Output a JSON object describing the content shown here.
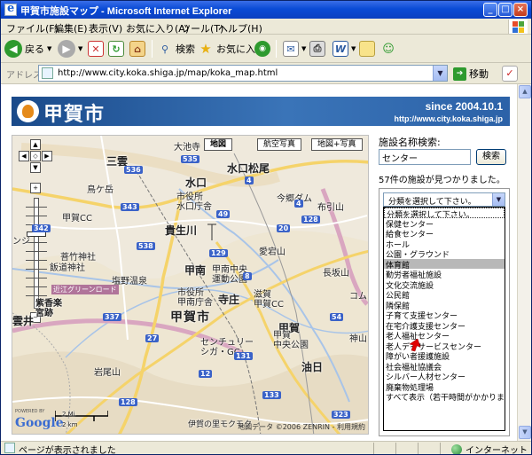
{
  "window": {
    "title": "甲賀市施設マップ - Microsoft Internet Explorer",
    "controls": {
      "minimize": "_",
      "maximize": "□",
      "close": "×"
    }
  },
  "menu": [
    "ファイル(F)",
    "編集(E)",
    "表示(V)",
    "お気に入り(A)",
    "ツール(T)",
    "ヘルプ(H)"
  ],
  "toolbar": {
    "back_label": "戻る",
    "search_label": "検索",
    "favorites_label": "お気に入り"
  },
  "address": {
    "label": "アドレス(D)",
    "url": "http://www.city.koka.shiga.jp/map/koka_map.html",
    "go_label": "移動"
  },
  "banner": {
    "brand": "甲賀市",
    "since": "since 2004.10.1",
    "site": "http://www.city.koka.shiga.jp"
  },
  "map": {
    "type_buttons": [
      "地図",
      "航空写真",
      "地図+写真"
    ],
    "active_type": "地図",
    "labels": {
      "oikecho": "大池寺",
      "mikumo": "三雲",
      "minakuchi_matsuo": "水口松尾",
      "minakuchi": "水口",
      "shiyakusho": "市役所\n水口庁舎",
      "imajuku_dam": "今郷ダム",
      "nunobikiyama": "布引山",
      "ugaya": "鳥ケ岳",
      "koka_cc": "甲賀CC",
      "kiryu": "菩竹神社",
      "hanzo": "飯道神社",
      "kifukawa": "貴生川",
      "atagoyama": "愛宕山",
      "shigaraki_onsen": "塩野温泉",
      "konan": "甲南",
      "konan_center": "甲南中央\n運動公園",
      "iwaomiya": "紫香楽\n宮跡",
      "shiyakusho_konan": "市役所\n甲南庁舎",
      "tera": "寺庄",
      "city_name": "甲賀市",
      "nagamatsuyama": "長坂山",
      "shiga_cc": "滋賀\n甲賀CC",
      "koka": "甲賀",
      "koka_center": "甲賀\n中央公園",
      "century": "センチュリー\nシガ・GC",
      "kamino": "神山",
      "iwaoyama": "岩尾山",
      "aburahi": "油日",
      "jyomi_cc": "信楽CC",
      "gengi": "ンジ",
      "kirino": "雲井",
      "kokoro": "コムウ",
      "omin_green": "近江グリーンロード",
      "shinmeiyama": "新名神高速道路",
      "koka_bottom": "伊賀の里モクモク"
    },
    "scale_mi": "2 Mi",
    "scale_km": "2 km",
    "google": "Google",
    "powered_by": "POWERED BY",
    "copyright": "地図データ ©2006 ZENRIN - 利用規約",
    "route_numbers": [
      "536",
      "535",
      "342",
      "343",
      "538",
      "4",
      "129",
      "20",
      "128",
      "49",
      "4",
      "54",
      "131",
      "27",
      "128",
      "133",
      "337",
      "8",
      "12",
      "323",
      "337",
      "19",
      "309",
      "307"
    ]
  },
  "panel": {
    "search_label": "施設名称検索:",
    "search_value": "センター",
    "search_button": "検索",
    "result_count": "57件の施設が見つかりました。",
    "select_value": "分類を選択して下さい。",
    "options": [
      "分類を選択して下さい。",
      "保健センター",
      "給食センター",
      "ホール",
      "公園・グラウンド",
      "体育館",
      "勤労者福祉施設",
      "文化交流施設",
      "公民館",
      "隣保館",
      "子育て支援センター",
      "在宅介護支援センター",
      "老人福祉センター",
      "老人デイサービスセンター",
      "障がい者援護施設",
      "社会福祉協議会",
      "シルバー人材センター",
      "廃棄物処理場",
      "すべて表示（若干時間がかかります"
    ],
    "selected_index": 5
  },
  "status": {
    "text": "ページが表示されました",
    "zone": "インターネット"
  },
  "colors": {
    "title_blue": "#0a4bd6",
    "chrome": "#ece9d8",
    "banner": "#2c62a8",
    "highway": "#d9a6c0",
    "road_major": "#f5d36a",
    "water": "#a8c4e8",
    "cursor_red": "#e00000"
  }
}
